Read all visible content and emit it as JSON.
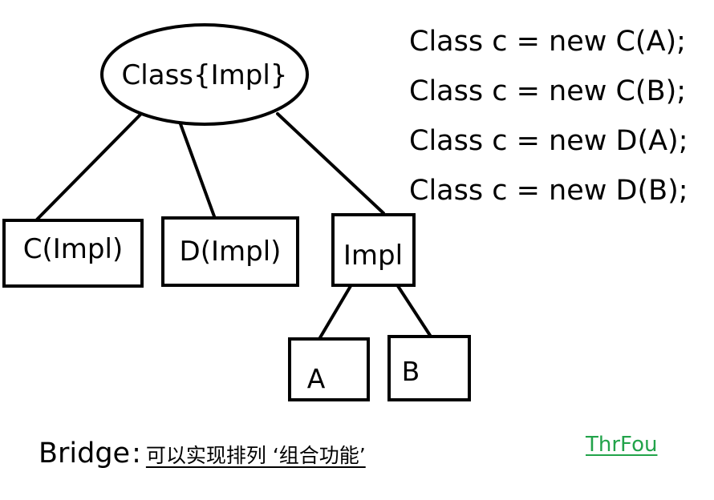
{
  "nodes": {
    "root": "Class{Impl}",
    "c_impl": "C(Impl)",
    "d_impl": "D(Impl)",
    "impl": "Impl",
    "a": "A",
    "b": "B"
  },
  "code_lines": [
    "Class c = new C(A);",
    "Class c = new C(B);",
    "Class c = new D(A);",
    "Class c = new D(B);"
  ],
  "caption": {
    "label": "Bridge",
    "separator": ":",
    "note": "可以实现排列 ‘组合功能’"
  },
  "brand": {
    "text": "ThrFou",
    "color": "#22a34a"
  }
}
